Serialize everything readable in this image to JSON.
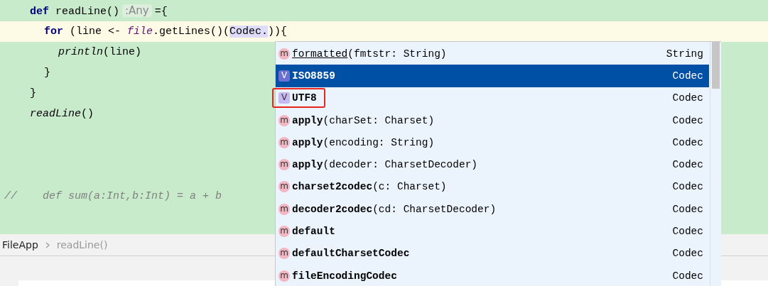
{
  "code_lines": [
    {
      "kind": "code",
      "current": false,
      "tokens": [
        {
          "text": "def",
          "kind": "keyword"
        },
        {
          "text": " readLine()",
          "kind": "plain"
        },
        {
          "text": ":Any",
          "kind": "hint"
        },
        {
          "text": "={",
          "kind": "plain"
        }
      ],
      "children": [
        {
          "kind": "code",
          "current": true,
          "tokens": [
            {
              "text": "for",
              "kind": "keyword"
            },
            {
              "text": " (line <- ",
              "kind": "plain"
            },
            {
              "text": "file",
              "kind": "field"
            },
            {
              "text": ".getLines()(",
              "kind": "plain"
            },
            {
              "text": "Codec.",
              "kind": "selection"
            },
            {
              "text": ")){",
              "kind": "plain"
            }
          ],
          "children": [
            {
              "kind": "code",
              "current": false,
              "tokens": [
                {
                  "text": "println",
                  "kind": "call"
                },
                {
                  "text": "(line)",
                  "kind": "plain"
                }
              ]
            }
          ]
        },
        {
          "kind": "code",
          "current": false,
          "tokens": [
            {
              "text": "}",
              "kind": "plain"
            }
          ]
        }
      ]
    },
    {
      "kind": "code",
      "current": false,
      "tokens": [
        {
          "text": "}",
          "kind": "plain"
        }
      ]
    },
    {
      "kind": "code",
      "current": false,
      "tokens": [
        {
          "text": "readLine",
          "kind": "call"
        },
        {
          "text": "()",
          "kind": "plain"
        }
      ]
    },
    {
      "kind": "blank",
      "current": false
    },
    {
      "kind": "blank",
      "current": false
    },
    {
      "kind": "blank",
      "current": false
    },
    {
      "kind": "comment",
      "current": false,
      "tokens": [
        {
          "text": "//    def sum(a:Int,b:Int) = a + b",
          "kind": "comment"
        }
      ]
    }
  ],
  "completion": {
    "items": [
      {
        "kind": "method",
        "badge": "m",
        "name": "formatted",
        "params": "(fmtstr: String)",
        "type": "String",
        "bold": false,
        "underlined": true,
        "selected": false,
        "outlined": false
      },
      {
        "kind": "value",
        "badge": "V",
        "name": "ISO8859",
        "type": "Codec",
        "bold": true,
        "underlined": false,
        "selected": true,
        "outlined": false
      },
      {
        "kind": "value",
        "badge": "V",
        "name": "UTF8",
        "type": "Codec",
        "bold": true,
        "underlined": false,
        "selected": false,
        "outlined": true
      },
      {
        "kind": "method",
        "badge": "m",
        "name": "apply",
        "params": "(charSet: Charset)",
        "type": "Codec",
        "bold": true,
        "underlined": false,
        "selected": false,
        "outlined": false
      },
      {
        "kind": "method",
        "badge": "m",
        "name": "apply",
        "params": "(encoding: String)",
        "type": "Codec",
        "bold": true,
        "underlined": false,
        "selected": false,
        "outlined": false
      },
      {
        "kind": "method",
        "badge": "m",
        "name": "apply",
        "params": "(decoder: CharsetDecoder)",
        "type": "Codec",
        "bold": true,
        "underlined": false,
        "selected": false,
        "outlined": false
      },
      {
        "kind": "method",
        "badge": "m",
        "name": "charset2codec",
        "params": "(c: Charset)",
        "type": "Codec",
        "bold": true,
        "underlined": false,
        "selected": false,
        "outlined": false
      },
      {
        "kind": "method",
        "badge": "m",
        "name": "decoder2codec",
        "params": "(cd: CharsetDecoder)",
        "type": "Codec",
        "bold": true,
        "underlined": false,
        "selected": false,
        "outlined": false
      },
      {
        "kind": "method",
        "badge": "m",
        "name": "default",
        "type": "Codec",
        "bold": true,
        "underlined": false,
        "selected": false,
        "outlined": false
      },
      {
        "kind": "method",
        "badge": "m",
        "name": "defaultCharsetCodec",
        "type": "Codec",
        "bold": true,
        "underlined": false,
        "selected": false,
        "outlined": false
      },
      {
        "kind": "method",
        "badge": "m",
        "name": "fileEncodingCodec",
        "type": "Codec",
        "bold": true,
        "underlined": false,
        "selected": false,
        "outlined": false
      }
    ]
  },
  "breadcrumb": [
    "FileApp",
    "readLine()"
  ]
}
